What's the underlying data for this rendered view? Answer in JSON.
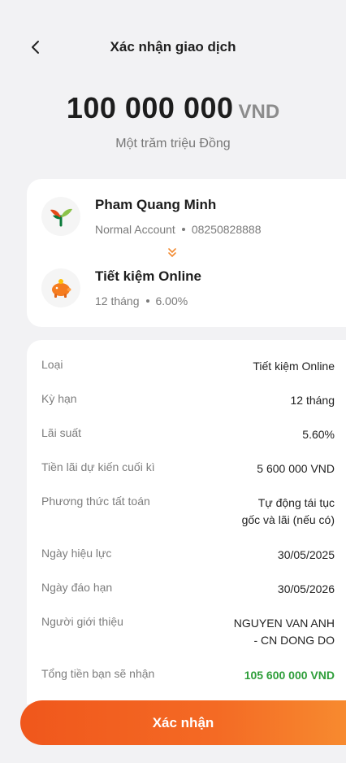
{
  "header": {
    "title": "Xác nhận giao dịch"
  },
  "amount": {
    "value": "100 000 000",
    "currency": "VND",
    "in_words": "Một trăm triệu Đồng"
  },
  "source_account": {
    "name": "Pham Quang Minh",
    "type": "Normal Account",
    "number": "08250828888",
    "icon": "bank-logo-icon"
  },
  "target_account": {
    "name": "Tiết kiệm Online",
    "term": "12 tháng",
    "rate": "6.00%",
    "icon": "piggy-bank-icon"
  },
  "details": [
    {
      "label": "Loại",
      "value": "Tiết kiệm Online"
    },
    {
      "label": "Kỳ hạn",
      "value": "12 tháng"
    },
    {
      "label": "Lãi suất",
      "value": "5.60%"
    },
    {
      "label": "Tiền lãi dự kiến cuối kì",
      "value": "5 600 000 VND"
    },
    {
      "label": "Phương thức tất toán",
      "value_line1": "Tự động tái tục",
      "value_line2": "gốc và lãi (nếu có)"
    },
    {
      "label": "Ngày hiệu lực",
      "value": "30/05/2025"
    },
    {
      "label": "Ngày đáo hạn",
      "value": "30/05/2026"
    },
    {
      "label": "Người giới thiệu",
      "value_line1": "NGUYEN VAN ANH",
      "value_line2": "- CN DONG DO"
    },
    {
      "label": "Tổng tiền bạn sẽ nhận",
      "value": "105 600 000 VND"
    }
  ],
  "colors": {
    "accent": "#f0571c",
    "total_green": "#2e9e3a"
  },
  "confirm_button": {
    "label": "Xác nhận"
  }
}
